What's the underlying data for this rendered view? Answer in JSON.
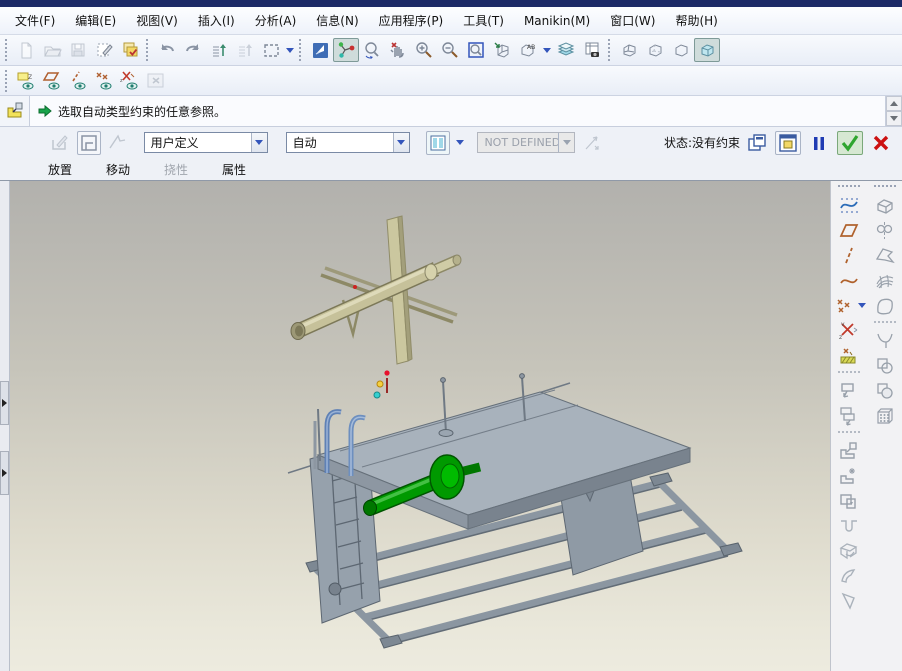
{
  "app": {
    "titlebar_color": "#1d2b67",
    "kind": "Pro/ENGINEER style CAD assembly window"
  },
  "menu_bar": {
    "items": [
      "文件(F)",
      "编辑(E)",
      "视图(V)",
      "插入(I)",
      "分析(A)",
      "信息(N)",
      "应用程序(P)",
      "工具(T)",
      "Manikin(M)",
      "窗口(W)",
      "帮助(H)"
    ]
  },
  "toolbar_top": {
    "icons": [
      "new-file-icon",
      "open-file-icon",
      "save-icon",
      "erase-icon",
      "regenerate-icon",
      "undo-icon",
      "redo-icon",
      "regenerate-list-icon",
      "update-list-icon",
      "selection-box-icon",
      "selection-caret",
      "plane-filter-icon",
      "drag-component-icon",
      "spin-center-icon",
      "stop-hand-icon",
      "zoom-in-icon",
      "zoom-out-icon",
      "refit-icon",
      "reorient-icon",
      "saved-views-icon",
      "layers-icon",
      "view-manager-icon",
      "wireframe-icon",
      "hidden-line-icon",
      "no-hidden-icon",
      "shaded-icon"
    ],
    "pressed": [
      "drag-component-icon",
      "shaded-icon"
    ]
  },
  "toolbar_datum": {
    "icons": [
      "plane-display-icon",
      "plane-tag-display-icon",
      "axis-display-icon",
      "point-display-icon",
      "csys-display-icon",
      "annotation-toggle-icon"
    ]
  },
  "message_area": {
    "prompt": "选取自动类型约束的任意参照。",
    "icon": "assemble-component-icon"
  },
  "dashboard": {
    "icons_left": [
      "datum-place-icon",
      "move-window-icon",
      "pointer-icon"
    ],
    "constraint_set_combo": {
      "value": "用户定义"
    },
    "constraint_type_combo": {
      "value": "自动"
    },
    "split_window_button": "split-window-icon",
    "offset_combo": {
      "value": "NOT DEFINED",
      "enabled": false
    },
    "flip_icon": "flip-constraint-icon",
    "status_label": "状态:没有约束",
    "right_buttons": [
      "child-window-icon",
      "main-window-icon",
      "pause-icon",
      "ok-check-icon",
      "cancel-x-icon"
    ],
    "colors": {
      "ok_green": "#2fa52f",
      "cancel_red": "#cc1111",
      "pause_blue": "#1f3bb3"
    }
  },
  "dashboard_tabs": [
    {
      "label": "放置",
      "enabled": true
    },
    {
      "label": "移动",
      "enabled": true
    },
    {
      "label": "挠性",
      "enabled": false
    },
    {
      "label": "属性",
      "enabled": true
    }
  ],
  "right_toolbar": {
    "column1_icons": [
      "sketch-tool-icon",
      "datum-plane-tool-icon",
      "datum-axis-tool-icon",
      "datum-curve-tool-icon",
      "datum-point-tool-icon",
      "point-caret",
      "datum-csys-tool-icon",
      "analysis-point-icon",
      "copy-geometry-icon",
      "publish-geometry-icon",
      "assemble-component-icon",
      "create-component-icon",
      "package-icon",
      "hole-icon",
      "shell-icon",
      "round-feature-icon",
      "chamfer-feature-icon"
    ],
    "column2_icons": [
      "extrude-icon",
      "revolve-icon",
      "sweep-icon",
      "boundary-blend-icon",
      "style-icon",
      "round-tool-icon",
      "merge-icon",
      "trim-icon",
      "pattern-icon"
    ]
  },
  "viewport": {
    "background_top": "#b2b1ad",
    "background_bottom": "#edebdf",
    "model_colors": {
      "cross_part_khaki": "#c6c19a",
      "frame_gray": "#9aa5b0",
      "shaft_green": "#009900",
      "handle_blue": "#6d8fbf"
    },
    "scene": "exploded assembly: khaki cross-shaft component above a gray welded stand with green shaft and blue tube handles; 3D drag handle with red/yellow/cyan points between them"
  }
}
